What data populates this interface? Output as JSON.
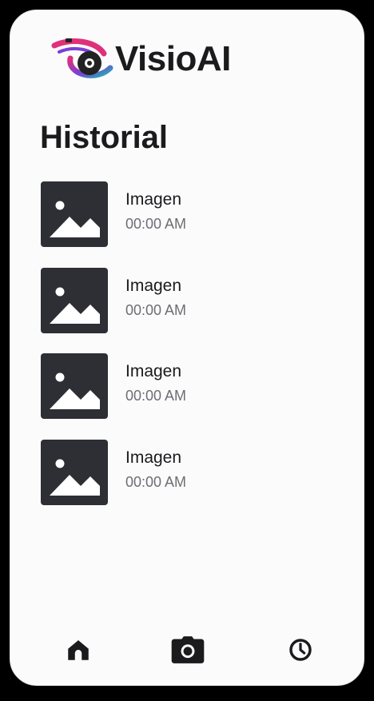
{
  "brand": {
    "name": "VisioAI",
    "logo_icon": "eye-swirl-logo"
  },
  "page": {
    "title": "Historial"
  },
  "history": [
    {
      "name": "Imagen",
      "time": "00:00 AM",
      "icon": "image-icon"
    },
    {
      "name": "Imagen",
      "time": "00:00 AM",
      "icon": "image-icon"
    },
    {
      "name": "Imagen",
      "time": "00:00 AM",
      "icon": "image-icon"
    },
    {
      "name": "Imagen",
      "time": "00:00 AM",
      "icon": "image-icon"
    }
  ],
  "bottom_nav": [
    {
      "icon": "home-icon"
    },
    {
      "icon": "camera-icon"
    },
    {
      "icon": "clock-icon"
    }
  ],
  "colors": {
    "background": "#fbfbfc",
    "text": "#1b1b1d",
    "muted": "#6d6d73",
    "thumb": "#2e2f34",
    "logo_pink": "#e0307a",
    "logo_purple": "#7a3fd6",
    "logo_teal": "#1fb6b0"
  }
}
